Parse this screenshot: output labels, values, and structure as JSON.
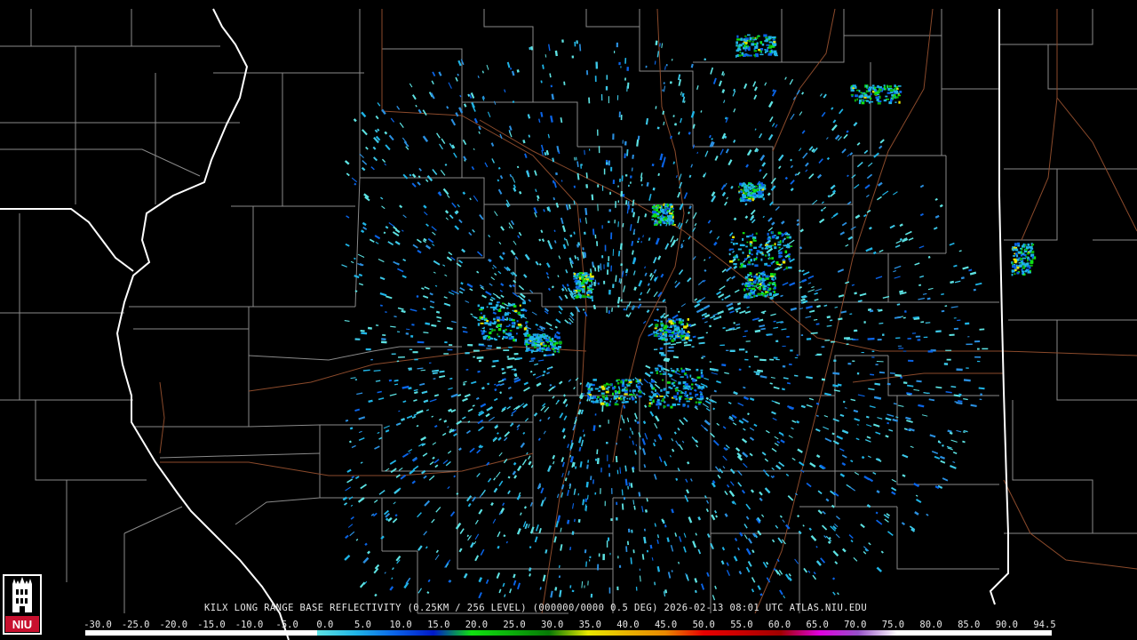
{
  "map": {
    "title": "KILX LONG RANGE BASE REFLECTIVITY (0.25KM / 256 LEVEL) (000000/0000 0.5 DEG) 2026-02-13 08:01 UTC  ATLAS.NIU.EDU",
    "radar_site": "KILX",
    "background_color": "#000000",
    "county_line_color": "#8a8a8a",
    "state_line_color": "#ffffff",
    "highway_color": "#8b4a2b"
  },
  "legend": {
    "labels": [
      "-30.0",
      "-25.0",
      "-20.0",
      "-15.0",
      "-10.0",
      "-5.0",
      "0.0",
      "5.0",
      "10.0",
      "15.0",
      "20.0",
      "25.0",
      "30.0",
      "35.0",
      "40.0",
      "45.0",
      "50.0",
      "55.0",
      "60.0",
      "65.0",
      "70.0",
      "75.0",
      "80.0",
      "85.0",
      "90.0",
      "94.5"
    ],
    "colors": [
      "#ffffff",
      "#ffffff",
      "#ffffff",
      "#ffffff",
      "#ffffff",
      "#ffffff",
      "#5de3e3",
      "#1fb4e6",
      "#0a64e8",
      "#0018c8",
      "#10e010",
      "#0bb00b",
      "#067806",
      "#e8e800",
      "#e8b400",
      "#e88800",
      "#e80000",
      "#c80000",
      "#a00000",
      "#e000e0",
      "#9650c8",
      "#ffffff",
      "#ffffff",
      "#ffffff",
      "#ffffff"
    ]
  },
  "logo": {
    "text": "NIU",
    "color": "#c8102e"
  }
}
